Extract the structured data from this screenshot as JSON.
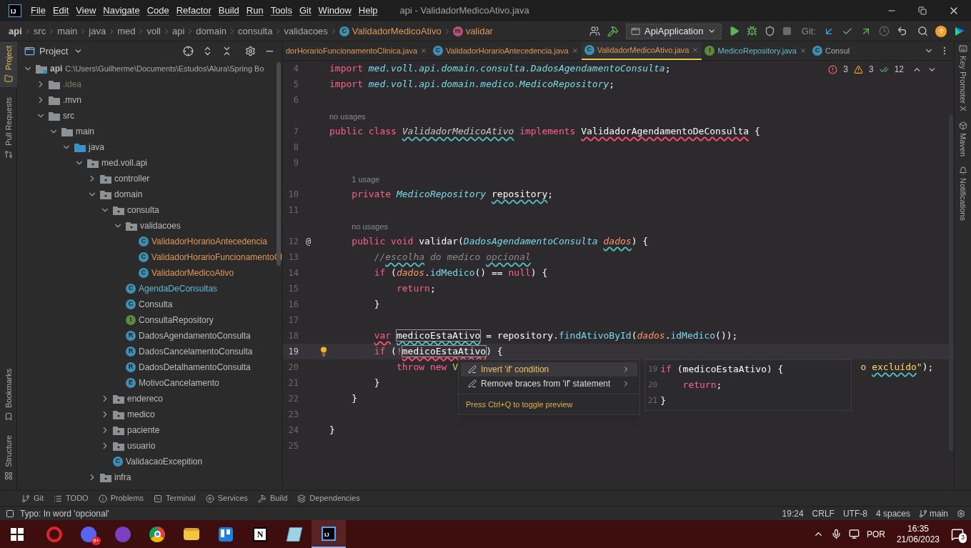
{
  "title_bar": {
    "logo": "IJ",
    "menus": [
      "File",
      "Edit",
      "View",
      "Navigate",
      "Code",
      "Refactor",
      "Build",
      "Run",
      "Tools",
      "Git",
      "Window",
      "Help"
    ],
    "title": "api - ValidadorMedicoAtivo.java"
  },
  "breadcrumbs": [
    {
      "text": "api",
      "kind": "module"
    },
    {
      "text": "src",
      "kind": "folder"
    },
    {
      "text": "main",
      "kind": "folder"
    },
    {
      "text": "java",
      "kind": "folder"
    },
    {
      "text": "med",
      "kind": "folder"
    },
    {
      "text": "voll",
      "kind": "folder"
    },
    {
      "text": "api",
      "kind": "folder"
    },
    {
      "text": "domain",
      "kind": "folder"
    },
    {
      "text": "consulta",
      "kind": "folder"
    },
    {
      "text": "validacoes",
      "kind": "folder"
    },
    {
      "text": "ValidadorMedicoAtivo",
      "kind": "class",
      "icon_letter": "C"
    },
    {
      "text": "validar",
      "kind": "method",
      "icon_letter": "m"
    }
  ],
  "toolbar": {
    "run_config": "ApiApplication",
    "git_label": "Git:"
  },
  "left_stripe": {
    "top": [
      {
        "label": "Project",
        "kind": "folder",
        "selected": true
      },
      {
        "label": "Pull Requests",
        "kind": "pull",
        "selected": false
      }
    ],
    "bottom": [
      {
        "label": "Bookmarks",
        "kind": "bookmark",
        "selected": false
      },
      {
        "label": "Structure",
        "kind": "structure",
        "selected": false
      }
    ]
  },
  "project_panel": {
    "title": "Project",
    "tree": [
      {
        "name": "api",
        "kind": "module",
        "path": "C:\\Users\\Guilherme\\Documents\\Estudos\\Alura\\Spring Bo",
        "color": "#bbbbbb",
        "expanded": true,
        "children": [
          {
            "name": ".idea",
            "kind": "folder",
            "color": "#7b7a62",
            "expanded": false
          },
          {
            "name": ".mvn",
            "kind": "folder",
            "color": "#bbbbbb",
            "expanded": false
          },
          {
            "name": "src",
            "kind": "folder",
            "color": "#bbbbbb",
            "expanded": true,
            "children": [
              {
                "name": "main",
                "kind": "folder",
                "color": "#bbbbbb",
                "expanded": true,
                "children": [
                  {
                    "name": "java",
                    "kind": "source",
                    "color": "#bbbbbb",
                    "expanded": true,
                    "children": [
                      {
                        "name": "med.voll.api",
                        "kind": "package",
                        "color": "#bbbbbb",
                        "expanded": true,
                        "children": [
                          {
                            "name": "controller",
                            "kind": "package",
                            "color": "#bbbbbb",
                            "expanded": false
                          },
                          {
                            "name": "domain",
                            "kind": "package",
                            "color": "#bbbbbb",
                            "expanded": true,
                            "children": [
                              {
                                "name": "consulta",
                                "kind": "package",
                                "color": "#bbbbbb",
                                "expanded": true,
                                "children": [
                                  {
                                    "name": "validacoes",
                                    "kind": "package",
                                    "color": "#bbbbbb",
                                    "expanded": true,
                                    "children": [
                                      {
                                        "name": "ValidadorHorarioAntecedencia",
                                        "kind": "class",
                                        "icon_letter": "C",
                                        "color": "#e09656"
                                      },
                                      {
                                        "name": "ValidadorHorarioFuncionamentoCl",
                                        "kind": "class",
                                        "icon_letter": "C",
                                        "color": "#e09656"
                                      },
                                      {
                                        "name": "ValidadorMedicoAtivo",
                                        "kind": "class",
                                        "icon_letter": "C",
                                        "color": "#e09656"
                                      }
                                    ]
                                  },
                                  {
                                    "name": "AgendaDeConsultas",
                                    "kind": "class",
                                    "icon_letter": "C",
                                    "color": "#62b8cf"
                                  },
                                  {
                                    "name": "Consulta",
                                    "kind": "class",
                                    "icon_letter": "C",
                                    "color": "#bbbbbb"
                                  },
                                  {
                                    "name": "ConsultaRepository",
                                    "kind": "interface",
                                    "icon_letter": "I",
                                    "color": "#bbbbbb"
                                  },
                                  {
                                    "name": "DadosAgendamentoConsulta",
                                    "kind": "record",
                                    "icon_letter": "R",
                                    "color": "#bbbbbb"
                                  },
                                  {
                                    "name": "DadosCancelamentoConsulta",
                                    "kind": "record",
                                    "icon_letter": "R",
                                    "color": "#bbbbbb"
                                  },
                                  {
                                    "name": "DadosDetalhamentoConsulta",
                                    "kind": "record",
                                    "icon_letter": "R",
                                    "color": "#bbbbbb"
                                  },
                                  {
                                    "name": "MotivoCancelamento",
                                    "kind": "enum",
                                    "icon_letter": "E",
                                    "color": "#bbbbbb"
                                  }
                                ]
                              },
                              {
                                "name": "endereco",
                                "kind": "package",
                                "color": "#bbbbbb",
                                "expanded": false
                              },
                              {
                                "name": "medico",
                                "kind": "package",
                                "color": "#bbbbbb",
                                "expanded": false
                              },
                              {
                                "name": "paciente",
                                "kind": "package",
                                "color": "#bbbbbb",
                                "expanded": false
                              },
                              {
                                "name": "usuario",
                                "kind": "package",
                                "color": "#bbbbbb",
                                "expanded": false
                              },
                              {
                                "name": "ValidacaoExcepition",
                                "kind": "class",
                                "icon_letter": "C",
                                "color": "#bbbbbb"
                              }
                            ]
                          },
                          {
                            "name": "infra",
                            "kind": "package",
                            "color": "#bbbbbb",
                            "expanded": false
                          }
                        ]
                      }
                    ]
                  }
                ]
              }
            ]
          }
        ]
      }
    ]
  },
  "tabs": [
    {
      "label": "dorHorarioFuncionamentoClinica.java",
      "color": "#e09656",
      "selected": false,
      "closable": true
    },
    {
      "label": "ValidadorHorarioAntecedencia.java",
      "kind": "class",
      "icon_letter": "C",
      "color": "#e09656",
      "selected": false,
      "closable": true
    },
    {
      "label": "ValidadorMedicoAtivo.java",
      "kind": "class",
      "icon_letter": "C",
      "color": "#e09656",
      "selected": true,
      "closable": true
    },
    {
      "label": "MedicoRepository.java",
      "kind": "interface",
      "icon_letter": "I",
      "color": "#62b8cf",
      "selected": false,
      "closable": true
    },
    {
      "label": "Consul",
      "kind": "class",
      "icon_letter": "C",
      "color": "#a9a9a9",
      "selected": false,
      "closable": false
    }
  ],
  "inspections": {
    "errors": "3",
    "warnings": "3",
    "passed": "12"
  },
  "editor": {
    "lines": [
      {
        "number": "4",
        "tokens": [
          {
            "text": "import ",
            "kind": "keyword"
          },
          {
            "text": "med.voll.api.domain.consulta.DadosAgendamentoConsulta",
            "kind": "type"
          },
          {
            "text": ";",
            "kind": "plain"
          }
        ]
      },
      {
        "number": "5",
        "tokens": [
          {
            "text": "import ",
            "kind": "keyword"
          },
          {
            "text": "med.voll.api.domain.medico.MedicoRepository",
            "kind": "type"
          },
          {
            "text": ";",
            "kind": "plain"
          }
        ]
      },
      {
        "number": "6"
      },
      {
        "number": "7",
        "hint": "no usages",
        "tokens": [
          {
            "text": "public class ",
            "kind": "keyword"
          },
          {
            "text": "ValidadorMedicoAtivo",
            "kind": "declaration",
            "misspelled": true
          },
          {
            "text": " implements ",
            "kind": "keyword"
          },
          {
            "text": "ValidadorAgendamentoDeConsulta",
            "kind": "plain",
            "error": true
          },
          {
            "text": " {",
            "kind": "plain"
          }
        ]
      },
      {
        "number": "8"
      },
      {
        "number": "9"
      },
      {
        "number": "10",
        "hint": "1 usage",
        "tokens": [
          {
            "text": "    private ",
            "kind": "keyword"
          },
          {
            "text": "MedicoRepository ",
            "kind": "type"
          },
          {
            "text": "repository",
            "kind": "plain",
            "misspelled": true
          },
          {
            "text": ";",
            "kind": "plain"
          }
        ]
      },
      {
        "number": "11"
      },
      {
        "number": "12",
        "hint": "no usages",
        "gutter_text": "@",
        "tokens": [
          {
            "text": "    public void ",
            "kind": "keyword"
          },
          {
            "text": "validar(",
            "kind": "plain"
          },
          {
            "text": "DadosAgendamentoConsulta ",
            "kind": "type"
          },
          {
            "text": "dados",
            "kind": "param",
            "misspelled": true
          },
          {
            "text": ") {",
            "kind": "plain"
          }
        ]
      },
      {
        "number": "13",
        "tokens": [
          {
            "text": "        //",
            "kind": "comment"
          },
          {
            "text": "escolha",
            "kind": "comment",
            "misspelled": true
          },
          {
            "text": " do medico ",
            "kind": "comment"
          },
          {
            "text": "opcional",
            "kind": "comment",
            "misspelled": true
          }
        ]
      },
      {
        "number": "14",
        "tokens": [
          {
            "text": "        if",
            "kind": "keyword"
          },
          {
            "text": " (",
            "kind": "plain"
          },
          {
            "text": "dados",
            "kind": "param"
          },
          {
            "text": ".",
            "kind": "plain"
          },
          {
            "text": "idMedico",
            "kind": "call"
          },
          {
            "text": "() == ",
            "kind": "plain"
          },
          {
            "text": "null",
            "kind": "keyword"
          },
          {
            "text": ") {",
            "kind": "plain"
          }
        ]
      },
      {
        "number": "15",
        "tokens": [
          {
            "text": "            return",
            "kind": "keyword"
          },
          {
            "text": ";",
            "kind": "plain"
          }
        ]
      },
      {
        "number": "16",
        "tokens": [
          {
            "text": "        }",
            "kind": "plain"
          }
        ]
      },
      {
        "number": "17"
      },
      {
        "number": "18",
        "tokens": [
          {
            "text": "        var",
            "kind": "keyword",
            "error": true
          },
          {
            "text": " medicoEstaAtivo",
            "kind": "plain",
            "misspelled": true,
            "boxed": true
          },
          {
            "text": " = repository.",
            "kind": "plain"
          },
          {
            "text": "findAtivoById",
            "kind": "call"
          },
          {
            "text": "(",
            "kind": "plain"
          },
          {
            "text": "dados",
            "kind": "param"
          },
          {
            "text": ".",
            "kind": "plain"
          },
          {
            "text": "idMedico",
            "kind": "call"
          },
          {
            "text": "());",
            "kind": "plain"
          }
        ]
      },
      {
        "number": "19",
        "current": true,
        "bulb": true,
        "tokens": [
          {
            "text": "        if",
            "kind": "keyword"
          },
          {
            "text": " (",
            "kind": "plain"
          },
          {
            "text": "!",
            "kind": "keyword"
          },
          {
            "text": "medicoEstaAtivo",
            "kind": "plain",
            "error": true,
            "boxed": true
          },
          {
            "text": ") {",
            "kind": "plain"
          }
        ]
      },
      {
        "number": "20",
        "tokens": [
          {
            "text": "            throw new ",
            "kind": "keyword"
          },
          {
            "text": "V",
            "kind": "ctor"
          }
        ],
        "tail": [
          {
            "text": "o ",
            "kind": "string"
          },
          {
            "text": "excluído",
            "kind": "string",
            "misspelled": true
          },
          {
            "text": "\"",
            "kind": "string"
          },
          {
            "text": ");",
            "kind": "plain"
          }
        ]
      },
      {
        "number": "21",
        "tokens": [
          {
            "text": "        }",
            "kind": "plain"
          }
        ]
      },
      {
        "number": "22",
        "tokens": [
          {
            "text": "    }",
            "kind": "plain"
          }
        ]
      },
      {
        "number": "23"
      },
      {
        "number": "24",
        "tokens": [
          {
            "text": "}",
            "kind": "plain"
          }
        ]
      },
      {
        "number": "25"
      }
    ],
    "intention_menu": {
      "items": [
        {
          "text": "Invert 'if' condition",
          "selected": true,
          "submenu": true
        },
        {
          "text": "Remove braces from 'if' statement",
          "selected": false,
          "submenu": true
        }
      ],
      "footer": "Press Ctrl+Q to toggle preview",
      "preview": [
        {
          "number": "19",
          "tokens": [
            {
              "text": "if",
              "kind": "keyword"
            },
            {
              "text": " (medicoEstaAtivo) {",
              "kind": "plain"
            }
          ]
        },
        {
          "number": "20",
          "tokens": [
            {
              "text": "    return",
              "kind": "keyword"
            },
            {
              "text": ";",
              "kind": "plain"
            }
          ]
        },
        {
          "number": "21",
          "tokens": [
            {
              "text": "}",
              "kind": "plain"
            }
          ]
        }
      ]
    }
  },
  "right_stripe": [
    {
      "label": "Key Promoter X",
      "kind": "key"
    },
    {
      "label": "Maven",
      "kind": "maven"
    },
    {
      "label": "Notifications",
      "kind": "bell"
    }
  ],
  "tool_buttons": [
    {
      "label": "Git",
      "kind": "git"
    },
    {
      "label": "TODO",
      "kind": "list"
    },
    {
      "label": "Problems",
      "kind": "info"
    },
    {
      "label": "Terminal",
      "kind": "terminal"
    },
    {
      "label": "Services",
      "kind": "services"
    },
    {
      "label": "Build",
      "kind": "build"
    },
    {
      "label": "Dependencies",
      "kind": "layers"
    }
  ],
  "status_bar": {
    "message": "Typo: In word 'opcional'",
    "position": "19:24",
    "line_separator": "CRLF",
    "encoding": "UTF-8",
    "indent": "4 spaces",
    "branch": "main"
  },
  "taskbar": {
    "apps": [
      {
        "kind": "opera",
        "selected": false
      },
      {
        "kind": "discord",
        "badge": "9+",
        "selected": false
      },
      {
        "kind": "github",
        "selected": false
      },
      {
        "kind": "chrome",
        "selected": false
      },
      {
        "kind": "explorer",
        "selected": false
      },
      {
        "kind": "trello",
        "selected": false
      },
      {
        "kind": "notion",
        "label": "N",
        "selected": false
      },
      {
        "kind": "notes",
        "selected": false
      },
      {
        "kind": "intellij",
        "label": "IJ",
        "selected": true
      }
    ],
    "language": "POR",
    "time": "16:35",
    "date": "21/06/2023",
    "notification_count": "3"
  }
}
